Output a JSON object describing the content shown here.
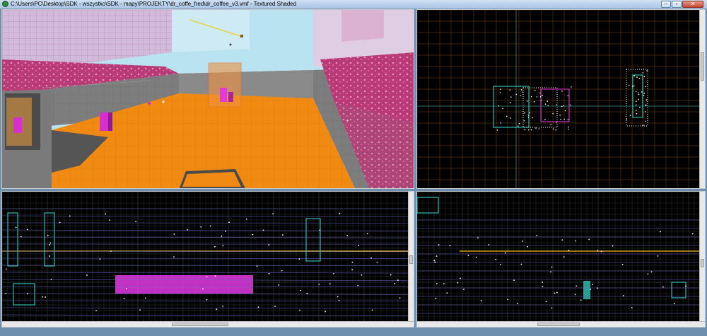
{
  "window": {
    "title": "C:\\Users\\PC\\Desktop\\SDK - wszystko\\SDK - mapy\\PROJEKTY\\dr_coffe_fred\\dr_coffee_v3.vmf - Textured Shaded",
    "minimize_glyph": "–",
    "maximize_glyph": "▫",
    "close_glyph": "✕"
  },
  "viewports": {
    "camera": {
      "render_mode": "Textured Shaded"
    },
    "top": {
      "view": "2D top"
    },
    "front": {
      "view": "2D front"
    },
    "side": {
      "view": "2D side"
    }
  },
  "colors": {
    "floor": "#f08a12",
    "sky": "#b9e3f1",
    "wall_pink": "#c1417d",
    "wall_gray": "#8a8a8a",
    "grid_line": "#5a5a5a",
    "grid_major": "#7a4a10",
    "axis": "#3b8e8e",
    "brush_white": "#ffffff",
    "brush_magenta": "#e23ae3",
    "brush_cyan": "#35e0d0",
    "brush_yellow": "#f0c020"
  },
  "icons": [
    "app-icon",
    "minimize-icon",
    "maximize-icon",
    "close-icon"
  ]
}
